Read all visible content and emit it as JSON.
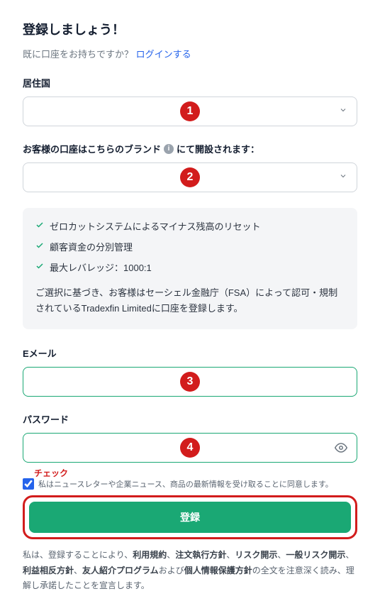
{
  "title": "登録しましょう！",
  "login": {
    "prompt": "既に口座をお持ちですか？",
    "link": "ログインする"
  },
  "fields": {
    "country": {
      "label": "居住国",
      "badge": "1"
    },
    "brand": {
      "label_prefix": "お客様の口座はこちらのブランド",
      "label_suffix": "にて開設されます：",
      "badge": "2"
    },
    "email": {
      "label": "Eメール",
      "badge": "3"
    },
    "password": {
      "label": "パスワード",
      "badge": "4"
    }
  },
  "features": {
    "items": [
      "ゼロカットシステムによるマイナス残高のリセット",
      "顧客資金の分別管理",
      "最大レバレッジ：1000:1"
    ],
    "description": "ご選択に基づき、お客様はセーシェル金融庁（FSA）によって認可・規制されているTradexfin Limitedに口座を登録します。"
  },
  "consent": {
    "annotation": "チェック",
    "text": "私はニュースレターや企業ニュース、商品の最新情報を受け取ることに同意します。"
  },
  "submit": {
    "label": "登録"
  },
  "terms": {
    "t1": "私は、登録することにより、",
    "b1": "利用規約",
    "b2": "注文執行方針",
    "b3": "リスク開示",
    "b4": "一般リスク開示",
    "b5": "利益相反方針",
    "b6": "友人紹介プログラム",
    "t2": "および",
    "b7": "個人情報保護方針",
    "t3": "の全文を注意深く読み、理解し承諾したことを宣言します。",
    "sep": "、"
  }
}
